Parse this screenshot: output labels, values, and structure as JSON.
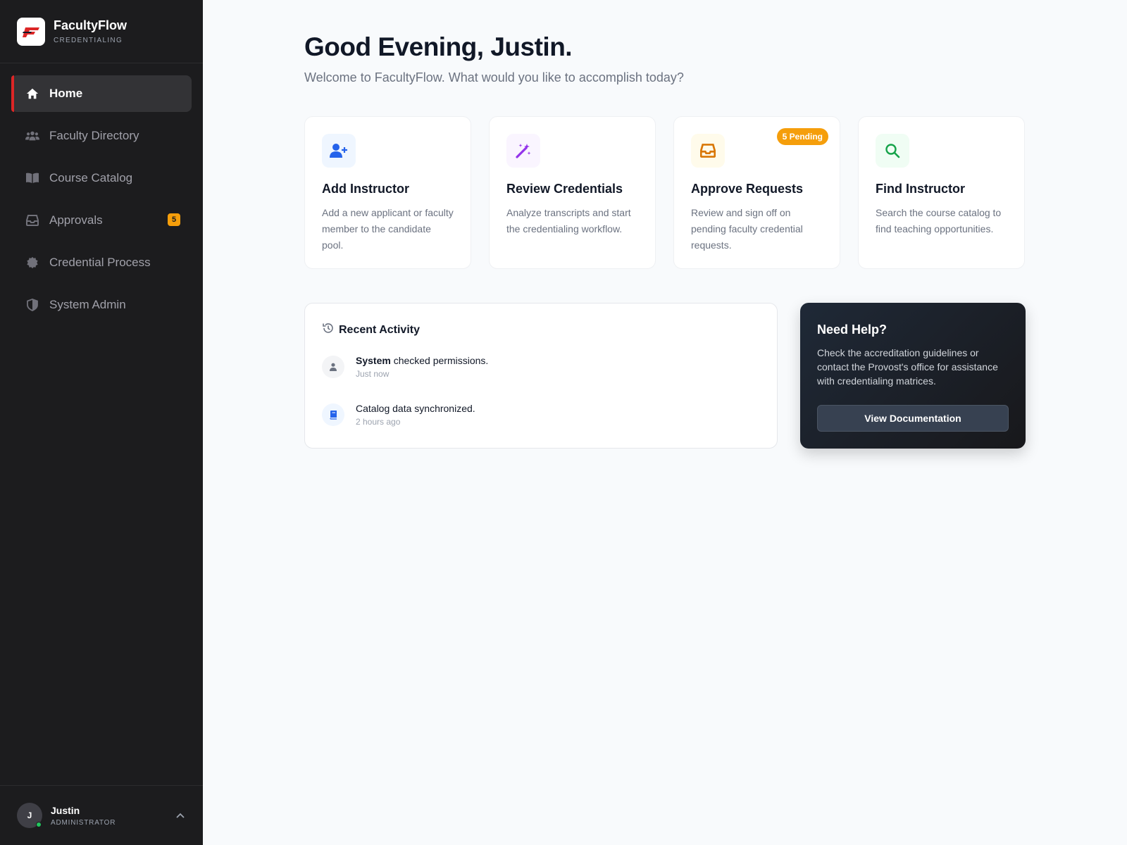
{
  "brand": {
    "name": "FacultyFlow",
    "subtitle": "CREDENTIALING"
  },
  "sidebar": {
    "items": [
      {
        "label": "Home",
        "icon": "home-icon",
        "active": true
      },
      {
        "label": "Faculty Directory",
        "icon": "users-icon"
      },
      {
        "label": "Course Catalog",
        "icon": "book-open-icon"
      },
      {
        "label": "Approvals",
        "icon": "inbox-icon",
        "badge": "5"
      },
      {
        "label": "Credential Process",
        "icon": "gear-badge-icon"
      },
      {
        "label": "System Admin",
        "icon": "shield-icon"
      }
    ]
  },
  "user": {
    "initial": "J",
    "name": "Justin",
    "role": "ADMINISTRATOR"
  },
  "main": {
    "greeting": "Good Evening, Justin.",
    "subtitle": "Welcome to FacultyFlow. What would you like to accomplish today?"
  },
  "cards": [
    {
      "title": "Add Instructor",
      "description": "Add a new applicant or faculty member to the candidate pool.",
      "icon": "user-plus-icon",
      "icon_color": "#2563eb",
      "icon_bg": "#eff6ff"
    },
    {
      "title": "Review Credentials",
      "description": "Analyze transcripts and start the credentialing workflow.",
      "icon": "magic-wand-icon",
      "icon_color": "#9333ea",
      "icon_bg": "#faf5ff"
    },
    {
      "title": "Approve Requests",
      "description": "Review and sign off on pending faculty credential requests.",
      "icon": "inbox-icon",
      "icon_color": "#d97706",
      "icon_bg": "#fffbeb",
      "pill": "5 Pending"
    },
    {
      "title": "Find Instructor",
      "description": "Search the course catalog to find teaching opportunities.",
      "icon": "search-icon",
      "icon_color": "#16a34a",
      "icon_bg": "#f0fdf4"
    }
  ],
  "activity": {
    "title": "Recent Activity",
    "items": [
      {
        "actor": "System",
        "text": " checked permissions.",
        "time": "Just now",
        "icon": "user-icon"
      },
      {
        "actor": "",
        "text": "Catalog data synchronized.",
        "time": "2 hours ago",
        "icon": "book-icon"
      }
    ]
  },
  "help": {
    "title": "Need Help?",
    "text": "Check the accreditation guidelines or contact the Provost's office for assistance with credentialing matrices.",
    "button": "View Documentation"
  },
  "colors": {
    "sidebar_bg": "#1c1c1e",
    "active_accent": "#dc2626",
    "badge": "#f59e0b",
    "page_bg": "#f8fafc"
  }
}
